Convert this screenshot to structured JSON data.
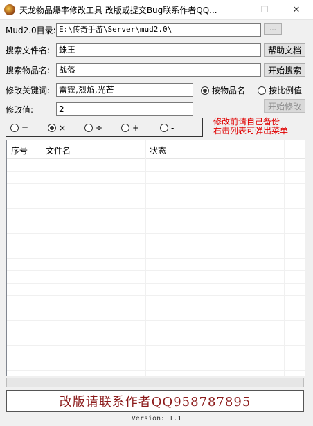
{
  "window": {
    "title": "天龙物品爆率修改工具 改版或提交Bug联系作者QQ...",
    "minimize": "—",
    "maximize": "☐",
    "close": "✕"
  },
  "form": {
    "dir_label": "Mud2.0目录:",
    "dir_value": "E:\\传奇手游\\Server\\mud2.0\\",
    "browse_label": "...",
    "search_file_label": "搜索文件名:",
    "search_file_value": "蛛王",
    "help_label": "帮助文档",
    "search_item_label": "搜索物品名:",
    "search_item_value": "战盔",
    "start_search_label": "开始搜索",
    "keyword_label": "修改关键词:",
    "keyword_value": "雷霆,烈焰,光芒",
    "by_name_label": "按物品名",
    "by_ratio_label": "按比例值",
    "value_label": "修改值:",
    "value_value": "2",
    "start_modify_label": "开始修改"
  },
  "operators": [
    {
      "symbol": "=",
      "selected": false
    },
    {
      "symbol": "×",
      "selected": true
    },
    {
      "symbol": "÷",
      "selected": false
    },
    {
      "symbol": "+",
      "selected": false
    },
    {
      "symbol": "-",
      "selected": false
    }
  ],
  "warning": {
    "line1": "修改前请自己备份",
    "line2": "右击列表可弹出菜单"
  },
  "list": {
    "columns": [
      "序号",
      "文件名",
      "状态"
    ]
  },
  "banner": "改版请联系作者QQ958787895",
  "version": "Version: 1.1",
  "colors": {
    "warning": "#e00000",
    "banner_text": "#8b1a1a"
  }
}
